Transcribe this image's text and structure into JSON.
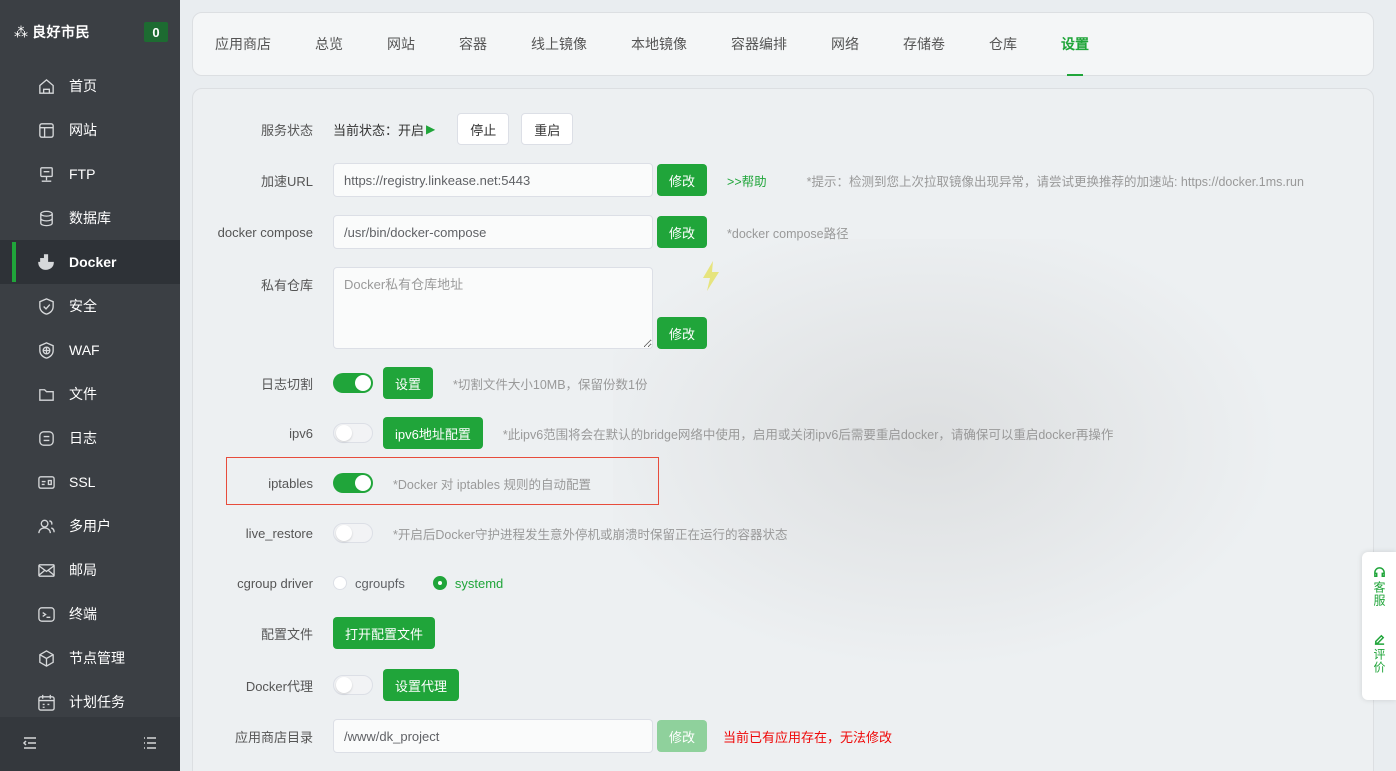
{
  "brand": {
    "name": "良好市民",
    "badge": "0"
  },
  "sidebar": {
    "items": [
      {
        "label": "首页",
        "icon": "home-icon"
      },
      {
        "label": "网站",
        "icon": "website-icon"
      },
      {
        "label": "FTP",
        "icon": "ftp-icon"
      },
      {
        "label": "数据库",
        "icon": "database-icon"
      },
      {
        "label": "Docker",
        "icon": "docker-icon",
        "active": true
      },
      {
        "label": "安全",
        "icon": "shield-icon"
      },
      {
        "label": "WAF",
        "icon": "waf-icon"
      },
      {
        "label": "文件",
        "icon": "folder-icon"
      },
      {
        "label": "日志",
        "icon": "log-icon"
      },
      {
        "label": "SSL",
        "icon": "ssl-icon"
      },
      {
        "label": "多用户",
        "icon": "users-icon"
      },
      {
        "label": "邮局",
        "icon": "mail-icon"
      },
      {
        "label": "终端",
        "icon": "terminal-icon"
      },
      {
        "label": "节点管理",
        "icon": "node-icon"
      },
      {
        "label": "计划任务",
        "icon": "calendar-icon"
      }
    ]
  },
  "tabs": [
    "应用商店",
    "总览",
    "网站",
    "容器",
    "线上镜像",
    "本地镜像",
    "容器编排",
    "网络",
    "存储卷",
    "仓库",
    "设置"
  ],
  "active_tab": "设置",
  "settings": {
    "service": {
      "label": "服务状态",
      "status_text": "当前状态：开启",
      "stop": "停止",
      "restart": "重启"
    },
    "accel": {
      "label": "加速URL",
      "value": "https://registry.linkease.net:5443",
      "modify": "修改",
      "help": ">>帮助",
      "hint": "*提示：检测到您上次拉取镜像出现异常，请尝试更换推荐的加速站: https://docker.1ms.run"
    },
    "compose": {
      "label": "docker compose",
      "value": "/usr/bin/docker-compose",
      "modify": "修改",
      "hint": "*docker compose路径"
    },
    "registry": {
      "label": "私有仓库",
      "placeholder": "Docker私有仓库地址",
      "modify": "修改"
    },
    "logcut": {
      "label": "日志切割",
      "on": true,
      "button": "设置",
      "hint": "*切割文件大小10MB，保留份数1份"
    },
    "ipv6": {
      "label": "ipv6",
      "on": false,
      "button": "ipv6地址配置",
      "hint": "*此ipv6范围将会在默认的bridge网络中使用，启用或关闭ipv6后需要重启docker，请确保可以重启docker再操作"
    },
    "iptables": {
      "label": "iptables",
      "on": true,
      "hint": "*Docker 对 iptables 规则的自动配置"
    },
    "live_restore": {
      "label": "live_restore",
      "on": false,
      "hint": "*开启后Docker守护进程发生意外停机或崩溃时保留正在运行的容器状态"
    },
    "cgroup": {
      "label": "cgroup driver",
      "options": [
        "cgroupfs",
        "systemd"
      ],
      "selected": "systemd"
    },
    "config": {
      "label": "配置文件",
      "button": "打开配置文件"
    },
    "proxy": {
      "label": "Docker代理",
      "on": false,
      "button": "设置代理"
    },
    "appdir": {
      "label": "应用商店目录",
      "value": "/www/dk_project",
      "modify": "修改",
      "error": "当前已有应用存在，无法修改"
    }
  },
  "float_tools": {
    "service": "客服",
    "review": "评价"
  },
  "colors": {
    "accent": "#20a53a",
    "sidebar_bg": "#3b3f44",
    "error": "#ef0808"
  }
}
